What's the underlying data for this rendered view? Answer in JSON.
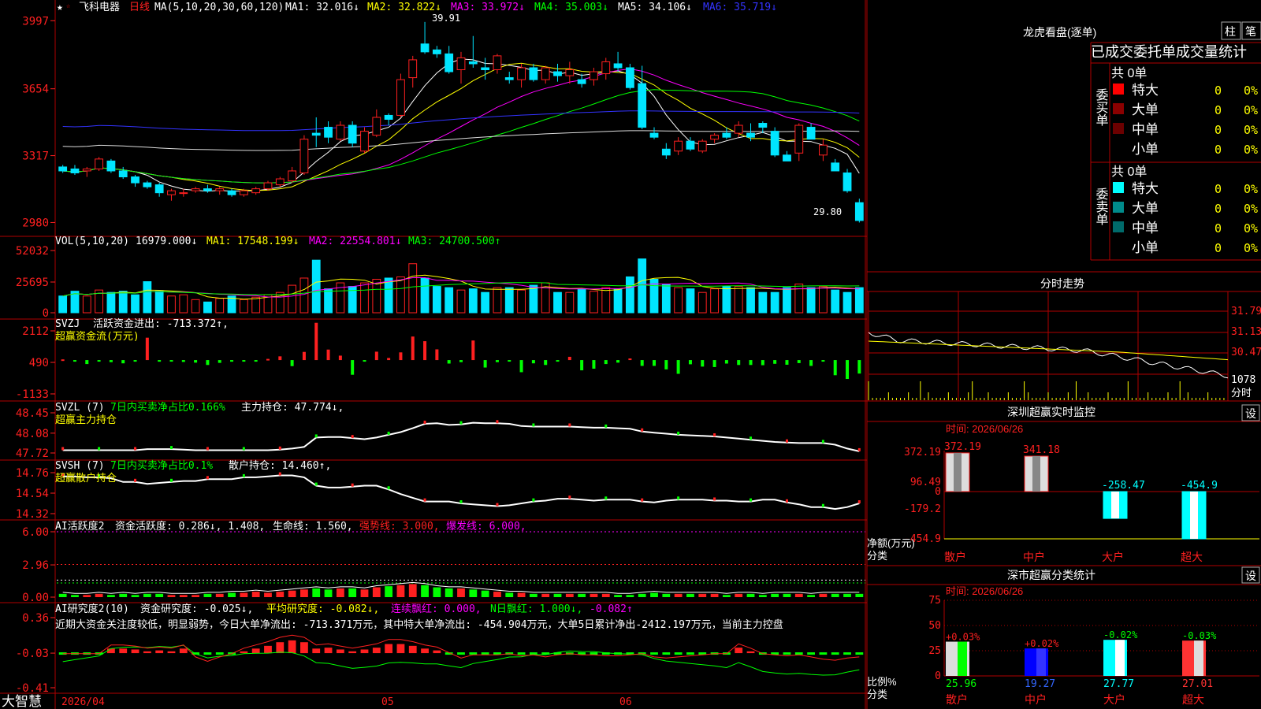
{
  "app": {
    "brand": "大智慧"
  },
  "colors": {
    "up": "#ff2020",
    "down": "#00e5ff",
    "axis": "#ff2020",
    "grid": "#b00000",
    "white": "#ffffff",
    "yellow": "#ffff00",
    "magenta": "#ff00ff",
    "green": "#00ff00",
    "blue": "#3333ff"
  },
  "price_panel": {
    "stock_name": "飞科电器",
    "period": "日线",
    "star_icon": "star-icon",
    "ma_params": "MA(5,10,20,30,60,120)",
    "ma_labels": [
      "MA1: 32.016↓",
      "MA2: 32.822↓",
      "MA3: 33.972↓",
      "MA4: 35.003↓",
      "MA5: 34.106↓",
      "MA6: 35.719↓"
    ],
    "high_label": "39.91",
    "low_label": "29.80",
    "y_ticks": [
      "3997",
      "3654",
      "3317",
      "2980"
    ]
  },
  "vol_panel": {
    "title": "VOL(5,10,20)",
    "labels": [
      "16979.000↓",
      "MA1: 17548.199↓",
      "MA2: 22554.801↓",
      "MA3: 24700.500↑"
    ],
    "y_ticks": [
      "52032",
      "25695",
      "0"
    ]
  },
  "svzj_panel": {
    "title": "SVZJ",
    "label": "活跃资金进出: -713.372↑,",
    "subtitle": "超赢资金流(万元)",
    "y_ticks": [
      "2112",
      "490",
      "-1133"
    ]
  },
  "svzl_panel": {
    "title": "SVZL (7)",
    "label1": "7日内买卖净占比0.166%",
    "label2": "主力持仓: 47.774↓,",
    "subtitle": "超赢主力持仓",
    "y_ticks": [
      "48.45",
      "48.08",
      "47.72"
    ]
  },
  "svsh_panel": {
    "title": "SVSH (7)",
    "label1": "7日内买卖净占比0.1%",
    "label2": "散户持仓: 14.460↑,",
    "subtitle": "超赢散户持仓",
    "y_ticks": [
      "14.76",
      "14.54",
      "14.32"
    ]
  },
  "ai_active_panel": {
    "title": "AI活跃度2",
    "label1": "资金活跃度: 0.286↓, 1.408,",
    "label2": "生命线: 1.560,",
    "label3": "强势线: 3.000,",
    "label4": "爆发线: 6.000,",
    "y_ticks": [
      "6.00",
      "2.96",
      "0.00"
    ]
  },
  "ai_research_panel": {
    "title": "AI研究度2(10)",
    "label1": "资金研究度: -0.025↓,",
    "label2": "平均研究度: -0.082↓,",
    "label3": "连续飘红: 0.000,",
    "label4": "N日飘红: 1.000↓,",
    "label5": "-0.082↑",
    "comment": "近期大资金关注度较低，明显弱势，今日大单净流出: -713.371万元，其中特大单净流出: -454.904万元，大单5日累计净出-2412.197万元，当前主力控盘",
    "y_ticks": [
      "0.36",
      "-0.03",
      "-0.41"
    ]
  },
  "x_axis": {
    "labels": [
      "2026/04",
      "05",
      "06"
    ]
  },
  "dragon_tiger": {
    "title": "龙虎看盘(逐单)",
    "btn_bar": "柱",
    "btn_pen": "笔",
    "subtitle": "已成交委托单成交量统计",
    "buy_label": "委买单",
    "sell_label": "委卖单",
    "buy_total": "共 0单",
    "sell_total": "共 0单",
    "buy_rows": [
      {
        "name": "特大",
        "count": "0",
        "pct": "0%",
        "color": "#ff0000"
      },
      {
        "name": "大单",
        "count": "0",
        "pct": "0%",
        "color": "#8b0000"
      },
      {
        "name": "中单",
        "count": "0",
        "pct": "0%",
        "color": "#6b0000"
      },
      {
        "name": "小单",
        "count": "0",
        "pct": "0%",
        "color": ""
      }
    ],
    "sell_rows": [
      {
        "name": "特大",
        "count": "0",
        "pct": "0%",
        "color": "#00ffff"
      },
      {
        "name": "大单",
        "count": "0",
        "pct": "0%",
        "color": "#008b8b"
      },
      {
        "name": "中单",
        "count": "0",
        "pct": "0%",
        "color": "#006b6b"
      },
      {
        "name": "小单",
        "count": "0",
        "pct": "0%",
        "color": ""
      }
    ]
  },
  "intraday": {
    "title": "分时走势",
    "y_ticks": [
      "31.79",
      "31.13",
      "30.47",
      "1078",
      "分时"
    ]
  },
  "sz_monitor": {
    "title": "深圳超赢实时监控",
    "set_btn": "设",
    "time": "时间: 2026/06/26",
    "y_ticks": [
      "372.19",
      "96.49",
      "0",
      "-179.2",
      "-454.9"
    ],
    "unit": "净额(万元)",
    "cat_label": "分类",
    "categories": [
      "散户",
      "中户",
      "大户",
      "超大"
    ],
    "values": [
      372.19,
      341.18,
      -258.47,
      -454.9
    ],
    "value_labels": [
      "372.19",
      "341.18",
      "-258.47",
      "-454.9"
    ]
  },
  "sz_class": {
    "title": "深市超赢分类统计",
    "set_btn": "设",
    "time": "时间: 2026/06/26",
    "y_ticks": [
      "75",
      "50",
      "25",
      "0"
    ],
    "unit": "比例%",
    "cat_label": "分类",
    "categories": [
      "散户",
      "中户",
      "大户",
      "超大"
    ],
    "values": [
      25.96,
      19.27,
      27.77,
      27.01
    ],
    "value_labels": [
      "25.96",
      "19.27",
      "27.77",
      "27.01"
    ],
    "change_labels": [
      "+0.03%",
      "+0.02%",
      "-0.02%",
      "-0.03%"
    ]
  },
  "chart_data": [
    {
      "type": "candlestick",
      "title": "飞科电器 日线",
      "series_note": "daily OHLC, 2026/04 – 2026/06",
      "ylim": [
        29.5,
        40.3
      ],
      "ohlc": [
        [
          32.6,
          32.7,
          32.3,
          32.4
        ],
        [
          32.5,
          32.7,
          32.2,
          32.3
        ],
        [
          32.4,
          32.6,
          32.1,
          32.5
        ],
        [
          32.5,
          33.1,
          32.4,
          33.0
        ],
        [
          32.9,
          33.0,
          32.3,
          32.4
        ],
        [
          32.4,
          32.6,
          32.0,
          32.1
        ],
        [
          32.1,
          32.2,
          31.6,
          31.8
        ],
        [
          31.8,
          31.9,
          31.5,
          31.6
        ],
        [
          31.7,
          31.8,
          31.1,
          31.3
        ],
        [
          31.2,
          31.5,
          30.9,
          31.4
        ],
        [
          31.3,
          31.5,
          31.1,
          31.3
        ],
        [
          31.4,
          31.6,
          31.3,
          31.5
        ],
        [
          31.5,
          31.7,
          31.3,
          31.4
        ],
        [
          31.4,
          31.6,
          31.2,
          31.5
        ],
        [
          31.4,
          31.5,
          31.1,
          31.2
        ],
        [
          31.2,
          31.5,
          31.1,
          31.4
        ],
        [
          31.3,
          31.6,
          31.2,
          31.5
        ],
        [
          31.5,
          31.9,
          31.4,
          31.8
        ],
        [
          31.7,
          32.1,
          31.6,
          32.0
        ],
        [
          31.9,
          32.6,
          31.8,
          32.4
        ],
        [
          32.3,
          34.2,
          32.2,
          34.0
        ],
        [
          34.3,
          35.1,
          33.6,
          34.2
        ],
        [
          34.6,
          34.9,
          33.8,
          34.1
        ],
        [
          34.0,
          34.9,
          33.9,
          34.7
        ],
        [
          34.7,
          34.9,
          33.6,
          33.8
        ],
        [
          33.4,
          34.6,
          33.3,
          34.4
        ],
        [
          34.2,
          35.5,
          34.1,
          35.1
        ],
        [
          35.2,
          35.3,
          34.7,
          35.0
        ],
        [
          35.2,
          37.3,
          35.1,
          37.0
        ],
        [
          37.1,
          38.2,
          36.6,
          38.0
        ],
        [
          38.8,
          39.91,
          38.3,
          38.4
        ],
        [
          38.5,
          38.7,
          38.1,
          38.3
        ],
        [
          38.3,
          38.7,
          37.3,
          37.4
        ],
        [
          37.5,
          38.4,
          36.8,
          38.1
        ],
        [
          37.9,
          39.2,
          37.6,
          37.8
        ],
        [
          37.6,
          38.1,
          37.0,
          37.5
        ],
        [
          37.5,
          38.3,
          37.3,
          38.2
        ],
        [
          37.1,
          37.4,
          36.8,
          37.0
        ],
        [
          37.0,
          37.8,
          36.6,
          37.6
        ],
        [
          37.6,
          37.8,
          36.9,
          37.0
        ],
        [
          37.0,
          37.7,
          36.8,
          37.6
        ],
        [
          37.4,
          37.8,
          36.9,
          37.2
        ],
        [
          37.2,
          37.9,
          36.8,
          37.5
        ],
        [
          37.0,
          37.3,
          36.6,
          36.8
        ],
        [
          37.0,
          37.6,
          36.7,
          37.4
        ],
        [
          37.3,
          38.1,
          37.0,
          37.9
        ],
        [
          37.8,
          38.4,
          37.4,
          37.6
        ],
        [
          37.6,
          37.8,
          36.5,
          36.6
        ],
        [
          36.8,
          37.7,
          34.5,
          34.6
        ],
        [
          34.3,
          34.6,
          34.0,
          34.1
        ],
        [
          33.5,
          33.8,
          33.0,
          33.2
        ],
        [
          33.4,
          34.1,
          33.2,
          33.9
        ],
        [
          33.9,
          34.1,
          33.4,
          33.5
        ],
        [
          33.4,
          34.0,
          33.3,
          33.9
        ],
        [
          34.0,
          34.3,
          33.8,
          34.2
        ],
        [
          34.3,
          34.6,
          34.0,
          34.1
        ],
        [
          34.3,
          34.9,
          34.1,
          34.7
        ],
        [
          34.3,
          34.8,
          33.9,
          34.1
        ],
        [
          34.8,
          34.9,
          34.3,
          34.6
        ],
        [
          34.4,
          34.6,
          33.1,
          33.2
        ],
        [
          33.2,
          33.4,
          32.9,
          32.9
        ],
        [
          33.3,
          34.8,
          32.9,
          34.7
        ],
        [
          34.6,
          34.8,
          34.0,
          34.0
        ],
        [
          33.2,
          34.0,
          32.9,
          33.7
        ],
        [
          32.8,
          33.0,
          32.4,
          32.4
        ],
        [
          32.3,
          32.5,
          31.3,
          31.4
        ],
        [
          30.8,
          31.0,
          29.8,
          29.9
        ]
      ],
      "ma_lines": [
        "MA1",
        "MA2",
        "MA3",
        "MA4",
        "MA5",
        "MA6"
      ]
    },
    {
      "type": "bar",
      "title": "VOL(5,10,20)",
      "ylim": [
        0,
        52032
      ],
      "values": [
        14,
        18,
        14,
        19,
        17,
        18,
        15,
        26,
        18,
        14,
        15,
        11,
        9,
        12,
        14,
        11,
        13,
        15,
        17,
        23,
        29,
        44,
        20,
        25,
        22,
        25,
        28,
        29,
        30,
        41,
        29,
        22,
        21,
        19,
        20,
        17,
        21,
        21,
        19,
        23,
        25,
        17,
        17,
        20,
        18,
        21,
        20,
        30,
        45,
        28,
        24,
        21,
        20,
        17,
        20,
        22,
        22,
        21,
        17,
        17,
        21,
        24,
        21,
        22,
        19,
        17,
        21,
        19,
        15
      ]
    },
    {
      "type": "bar",
      "title": "SVZJ 活跃资金进出",
      "ylim": [
        -1133,
        2112
      ],
      "values": [
        30,
        -60,
        -170,
        -10,
        -90,
        -140,
        -60,
        960,
        -70,
        -20,
        -80,
        -110,
        -210,
        -120,
        -70,
        -40,
        -10,
        50,
        160,
        -260,
        350,
        1600,
        450,
        190,
        -630,
        -5,
        360,
        90,
        330,
        1010,
        810,
        460,
        -150,
        -90,
        840,
        -320,
        -90,
        -30,
        -520,
        -140,
        -210,
        -30,
        140,
        -440,
        -370,
        -170,
        -110,
        70,
        -250,
        -250,
        -400,
        -590,
        -180,
        -280,
        -300,
        -150,
        -210,
        -210,
        -220,
        -160,
        -200,
        -130,
        -250,
        -50,
        -650,
        -810,
        -580
      ]
    },
    {
      "type": "line",
      "title": "SVZL 主力持仓",
      "ylim": [
        47.72,
        48.45
      ],
      "values": [
        47.77,
        47.77,
        47.77,
        47.77,
        47.77,
        47.77,
        47.77,
        47.79,
        47.79,
        47.79,
        47.78,
        47.77,
        47.77,
        47.77,
        47.77,
        47.77,
        47.77,
        47.77,
        47.78,
        47.8,
        47.83,
        48.0,
        48.01,
        48.01,
        47.99,
        47.97,
        48.0,
        48.05,
        48.1,
        48.17,
        48.25,
        48.26,
        48.23,
        48.24,
        48.27,
        48.26,
        48.26,
        48.25,
        48.21,
        48.2,
        48.2,
        48.2,
        48.2,
        48.19,
        48.18,
        48.18,
        48.17,
        48.16,
        48.11,
        48.09,
        48.07,
        48.05,
        48.04,
        48.03,
        48.02,
        48.0,
        47.98,
        47.96,
        47.94,
        47.92,
        47.91,
        47.9,
        47.9,
        47.9,
        47.87,
        47.8,
        47.75
      ]
    },
    {
      "type": "line",
      "title": "SVSH 散户持仓",
      "ylim": [
        14.32,
        14.76
      ],
      "values": [
        14.72,
        14.72,
        14.71,
        14.71,
        14.7,
        14.66,
        14.66,
        14.64,
        14.65,
        14.66,
        14.67,
        14.67,
        14.69,
        14.69,
        14.69,
        14.71,
        14.71,
        14.72,
        14.73,
        14.73,
        14.71,
        14.62,
        14.6,
        14.6,
        14.61,
        14.62,
        14.62,
        14.58,
        14.53,
        14.49,
        14.45,
        14.45,
        14.45,
        14.43,
        14.42,
        14.41,
        14.4,
        14.41,
        14.43,
        14.45,
        14.46,
        14.48,
        14.48,
        14.47,
        14.46,
        14.47,
        14.47,
        14.47,
        14.45,
        14.44,
        14.46,
        14.47,
        14.47,
        14.47,
        14.46,
        14.46,
        14.45,
        14.45,
        14.47,
        14.47,
        14.44,
        14.42,
        14.39,
        14.39,
        14.37,
        14.39,
        14.43
      ]
    },
    {
      "type": "bar",
      "title": "AI活跃度2 资金活跃度",
      "ylim": [
        0,
        6.0
      ],
      "lines": {
        "生命线": 1.56,
        "强势线": 3.0,
        "爆发线": 6.0
      },
      "values": [
        0.3,
        0.2,
        0.2,
        0.3,
        0.2,
        0.3,
        0.2,
        0.3,
        0.3,
        0.2,
        0.2,
        0.2,
        0.3,
        0.3,
        0.4,
        0.4,
        0.5,
        0.4,
        0.5,
        0.6,
        0.7,
        0.8,
        0.7,
        0.8,
        0.8,
        0.7,
        0.9,
        1.0,
        1.1,
        1.2,
        1.1,
        0.9,
        0.8,
        0.8,
        0.7,
        0.6,
        0.5,
        0.4,
        0.4,
        0.3,
        0.3,
        0.3,
        0.3,
        0.3,
        0.3,
        0.3,
        0.2,
        0.2,
        0.3,
        0.4,
        0.3,
        0.3,
        0.3,
        0.3,
        0.3,
        0.2,
        0.3,
        0.3,
        0.2,
        0.3,
        0.3,
        0.3,
        0.2,
        0.3,
        0.3,
        0.3,
        0.3
      ]
    },
    {
      "type": "bar",
      "title": "AI研究度2(10)",
      "ylim": [
        -0.41,
        0.36
      ],
      "values": [
        -0.03,
        -0.03,
        -0.03,
        -0.03,
        0.05,
        0.05,
        0.04,
        0.02,
        0.03,
        0.02,
        0.05,
        -0.06,
        -0.1,
        -0.06,
        -0.03,
        0.02,
        0.05,
        0.08,
        0.12,
        0.14,
        0.12,
        0.05,
        0.06,
        0.04,
        0.02,
        0.04,
        0.06,
        0.1,
        0.1,
        0.08,
        0.05,
        0.03,
        -0.02,
        -0.07,
        -0.04,
        -0.04,
        -0.04,
        -0.03,
        -0.05,
        -0.04,
        -0.06,
        -0.04,
        -0.03,
        -0.04,
        -0.04,
        -0.05,
        -0.05,
        -0.04,
        -0.03,
        -0.06,
        -0.07,
        -0.06,
        -0.05,
        -0.04,
        -0.03,
        -0.03,
        0.06,
        0.02,
        -0.03,
        -0.04,
        -0.05,
        -0.04,
        -0.06,
        -0.08,
        -0.09,
        -0.07,
        -0.06
      ]
    }
  ]
}
